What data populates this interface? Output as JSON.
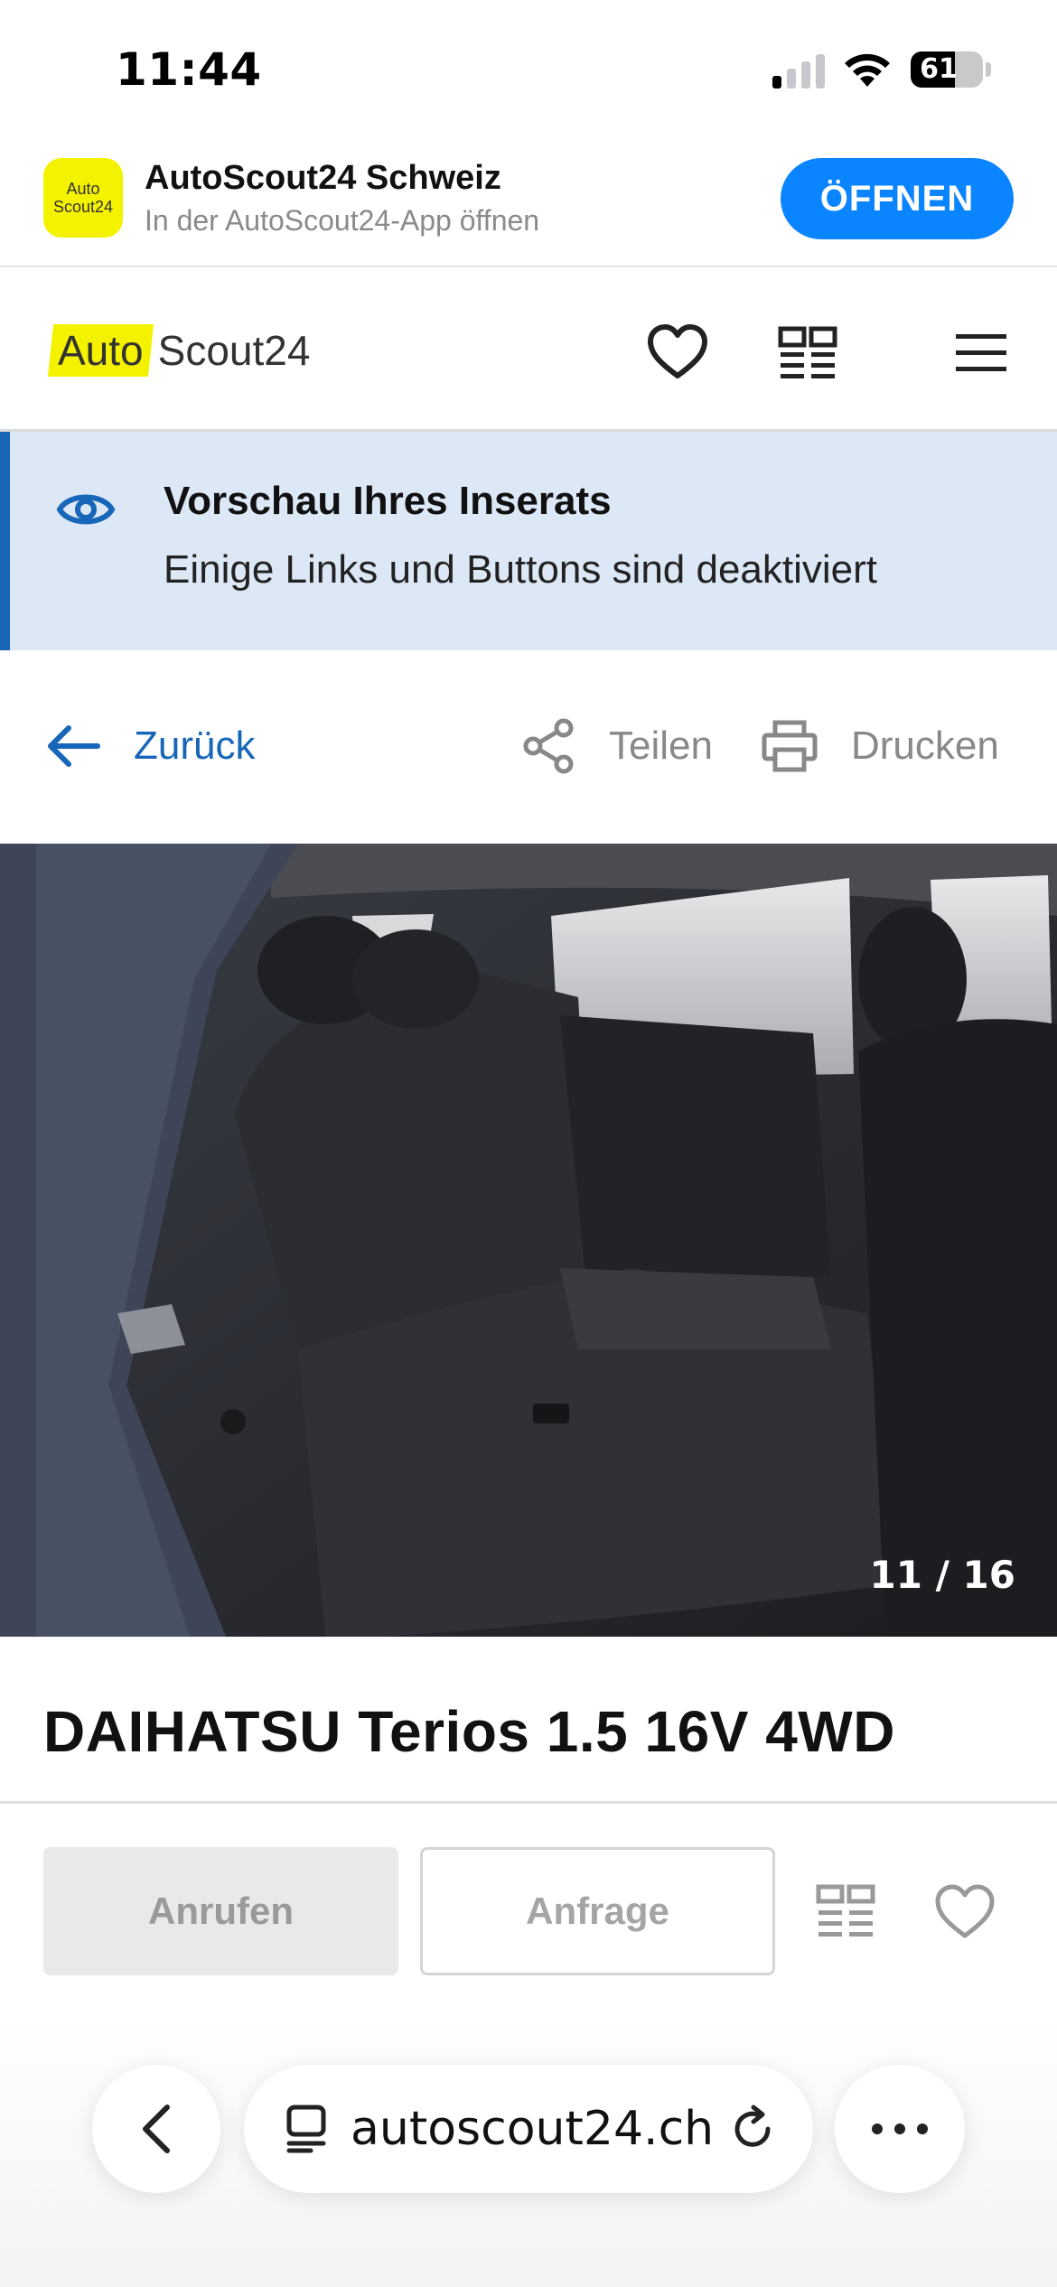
{
  "status_bar": {
    "time": "11:44",
    "battery": "61"
  },
  "app_banner": {
    "icon_line1": "Auto",
    "icon_line2": "Scout24",
    "title": "AutoScout24 Schweiz",
    "subtitle": "In der AutoScout24-App öffnen",
    "open_label": "ÖFFNEN"
  },
  "header": {
    "logo_auto": "Auto",
    "logo_scout": "Scout24",
    "icons": [
      "heart-icon",
      "compare-icon",
      "menu-icon"
    ]
  },
  "preview_notice": {
    "title": "Vorschau Ihres Inserats",
    "text": "Einige Links und Buttons sind deaktiviert"
  },
  "toolbar": {
    "back_label": "Zurück",
    "share_label": "Teilen",
    "print_label": "Drucken"
  },
  "gallery": {
    "counter": "11 / 16"
  },
  "listing": {
    "title": "DAIHATSU Terios 1.5 16V 4WD"
  },
  "actions": {
    "call_label": "Anrufen",
    "inquiry_label": "Anfrage"
  },
  "browser": {
    "url": "autoscout24.ch"
  },
  "colors": {
    "accent_blue": "#1766b8",
    "ios_blue": "#0a84ff",
    "brand_yellow": "#f5f200",
    "preview_bg": "#dde8f7"
  }
}
